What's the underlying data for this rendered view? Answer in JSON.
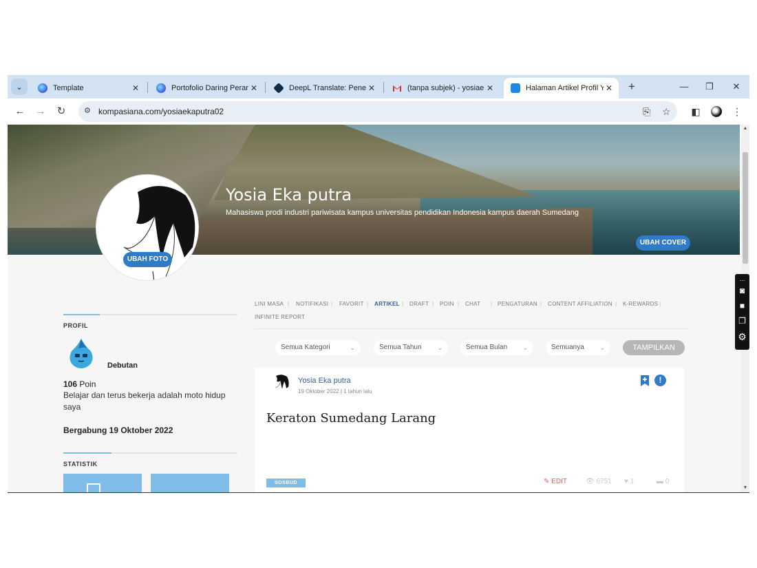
{
  "browser": {
    "tabs": [
      {
        "label": "Template",
        "icon": "canva-icon",
        "active": false
      },
      {
        "label": "Portofolio Daring Peranc",
        "icon": "canva-icon",
        "active": false
      },
      {
        "label": "DeepL Translate: Penerje",
        "icon": "deepl-icon",
        "active": false
      },
      {
        "label": "(tanpa subjek) - yosiaeka",
        "icon": "gmail-icon",
        "active": false
      },
      {
        "label": "Halaman Artikel Profil Yo",
        "icon": "kompasiana-icon",
        "active": true
      }
    ],
    "url": "kompasiana.com/yosiaekaputra02",
    "close_glyph": "✕",
    "new_tab_glyph": "+",
    "window_controls": {
      "minimize": "—",
      "restore": "❐",
      "close": "✕"
    }
  },
  "profile": {
    "name": "Yosia Eka putra",
    "bio": "Mahasiswa prodi industri pariwisata kampus universitas pendidikan Indonesia kampus daerah Sumedang",
    "change_cover": "UBAH COVER",
    "change_photo": "UBAH FOTO"
  },
  "sidebar": {
    "profil_title": "PROFIL",
    "badge": "Debutan",
    "points_value": "106",
    "points_label": "Poin",
    "motto": "Belajar dan terus bekerja adalah moto hidup saya",
    "joined": "Bergabung 19 Oktober 2022",
    "statistik_title": "STATISTIK"
  },
  "nav": {
    "items": [
      "LINI MASA",
      "NOTIFIKASI",
      "FAVORIT",
      "ARTIKEL",
      "DRAFT",
      "POIN",
      "CHAT",
      "PENGATURAN",
      "CONTENT AFFILIATION",
      "K-REWARDS",
      "INFINITE REPORT"
    ],
    "active": "ARTIKEL"
  },
  "filters": {
    "category": "Semua Kategori",
    "year": "Semua Tahun",
    "month": "Semua Bulan",
    "type": "Semuanya",
    "submit": "TAMPILKAN"
  },
  "article": {
    "author": "Yosia Eka putra",
    "date": "19 Oktober 2022 | 1 tahun lalu",
    "title": "Keraton Sumedang Larang",
    "tag": "SOSBUD",
    "edit": "EDIT",
    "views": "6751",
    "likes": "1",
    "comments": "0"
  },
  "colors": {
    "accent": "#2f7bc7",
    "tag": "#7fbde8",
    "link": "#2f5f9a",
    "tabstrip": "#d3e3f4"
  }
}
